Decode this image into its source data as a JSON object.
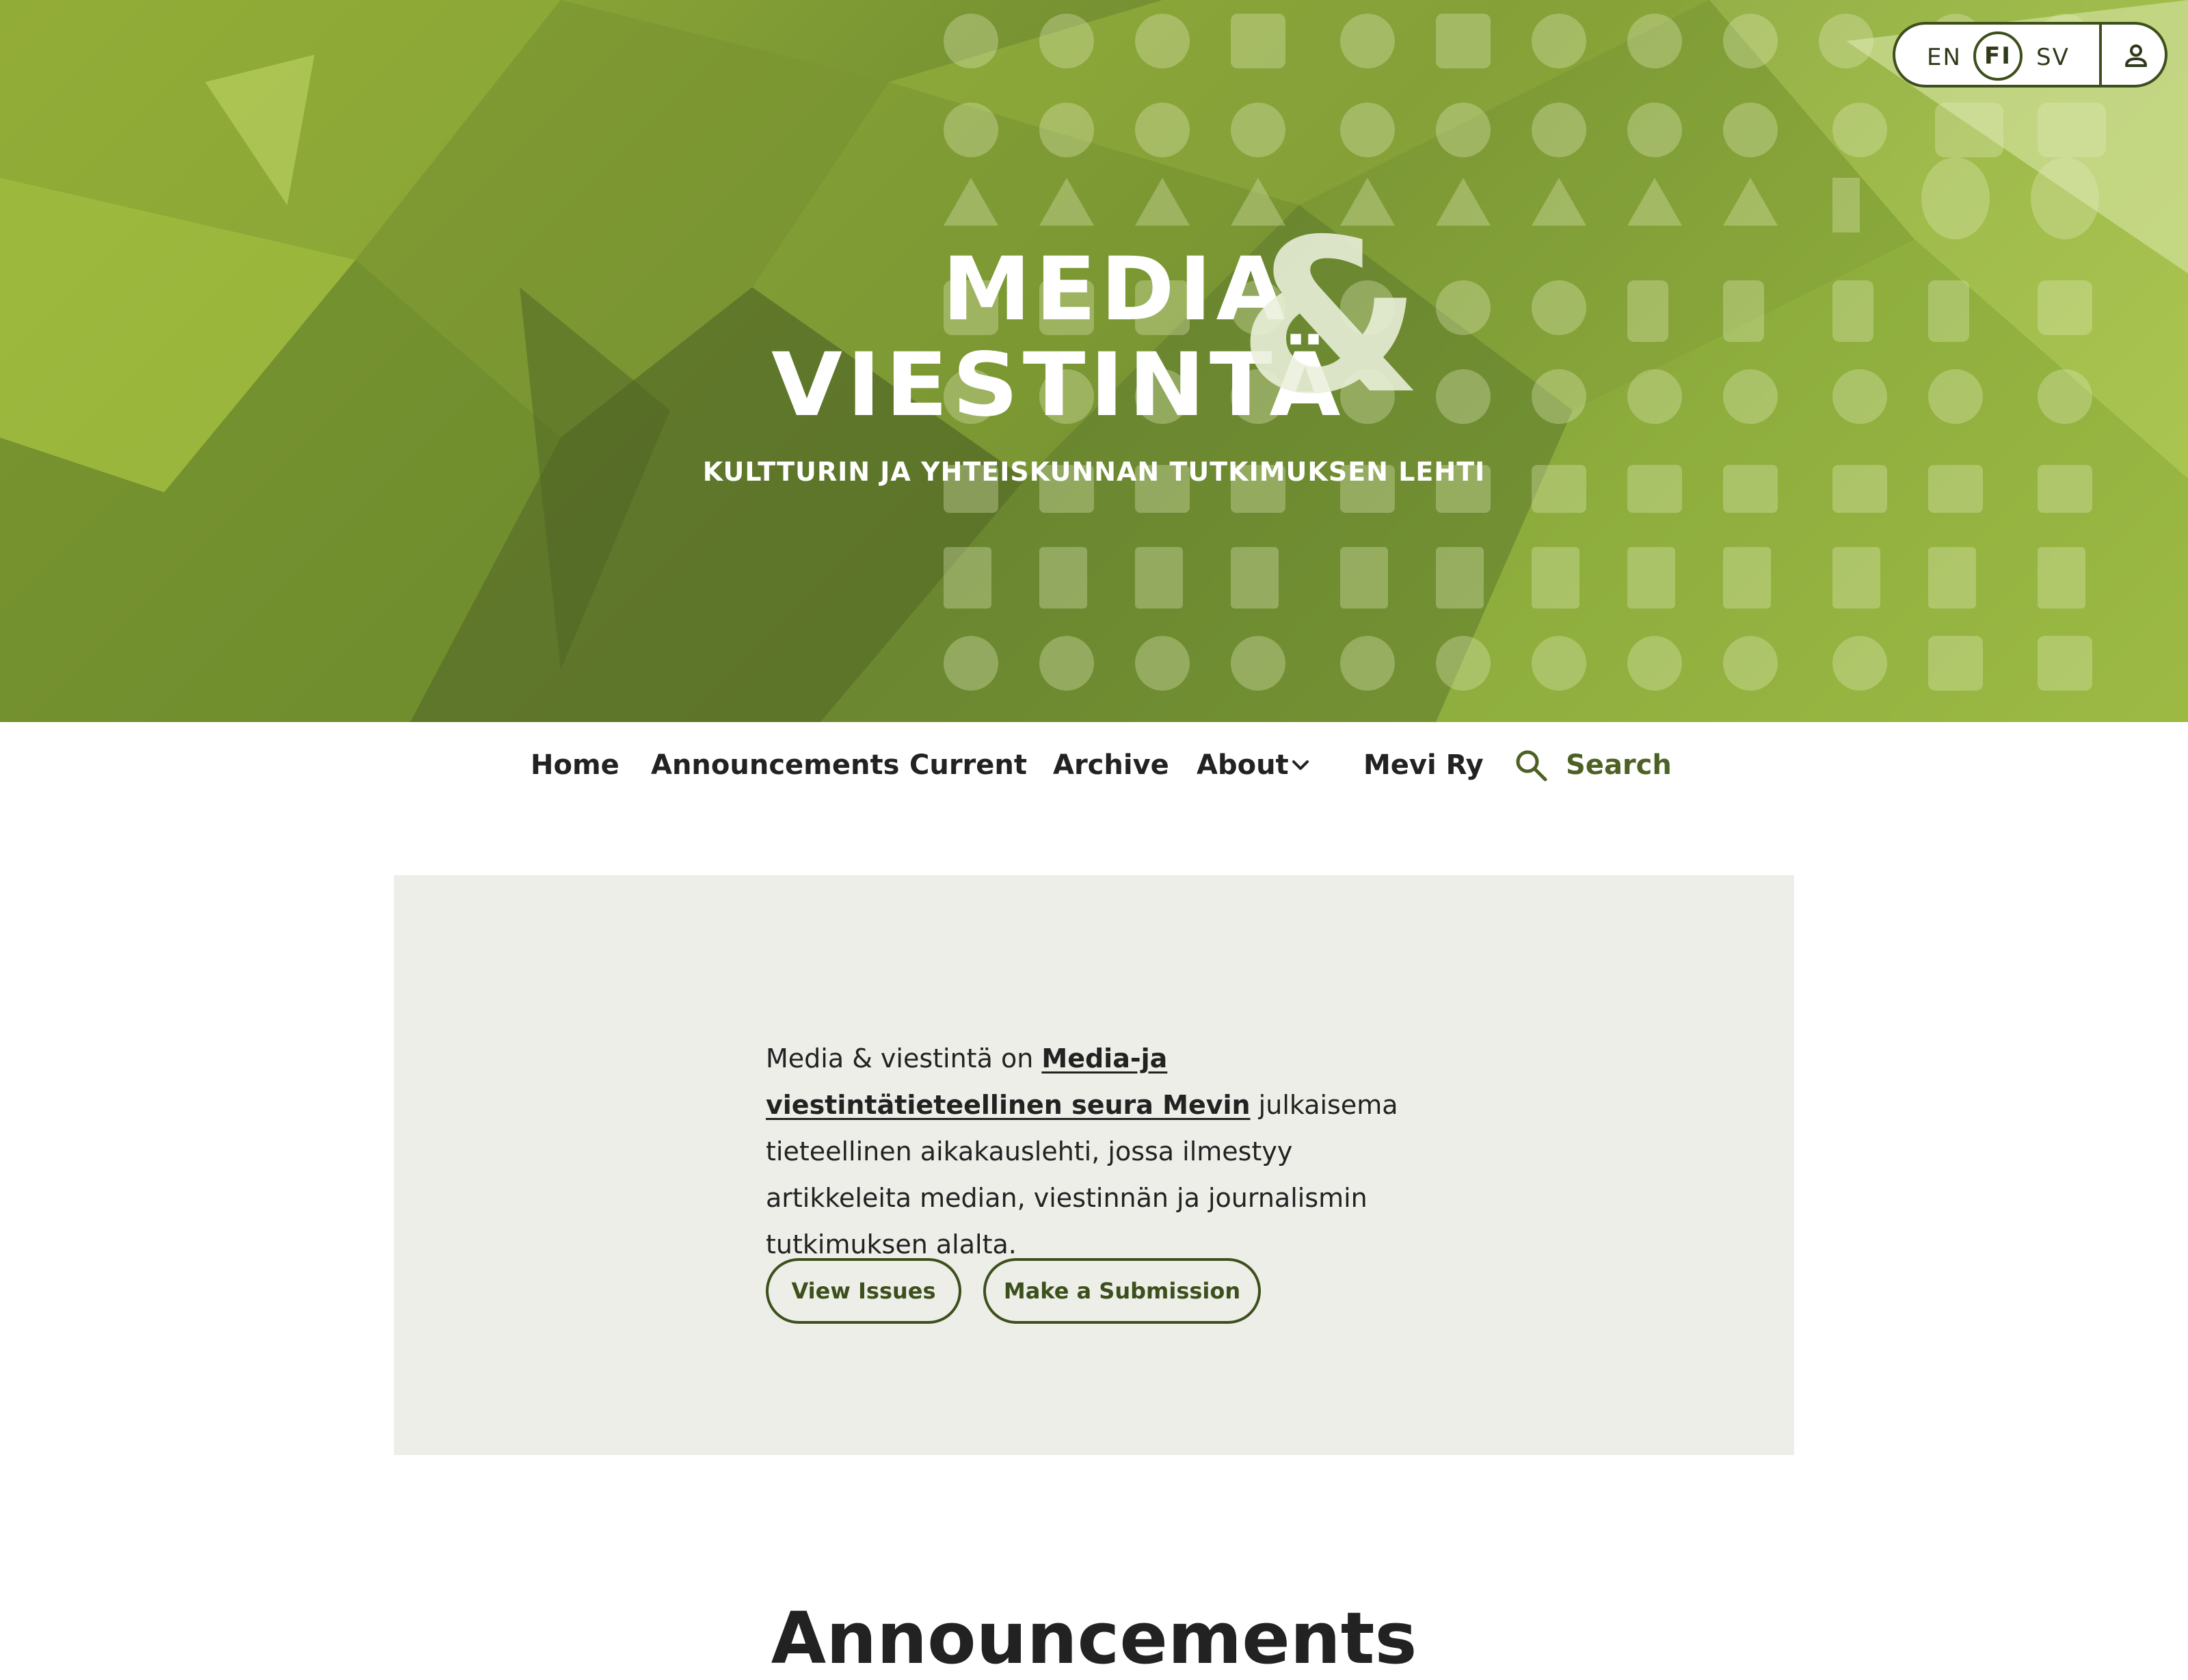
{
  "header": {
    "logo_line1": "MEDIA",
    "logo_line2": "VIESTINTÄ",
    "logo_ampersand": "&",
    "tagline": "KULTTURIN JA YHTEISKUNNAN TUTKIMUKSEN LEHTI",
    "languages": [
      "EN",
      "FI",
      "SV"
    ],
    "active_language": "FI",
    "user_icon": "user-icon"
  },
  "nav": {
    "items": [
      {
        "label": "Home"
      },
      {
        "label": "Announcements"
      },
      {
        "label": "Current"
      },
      {
        "label": "Archive"
      },
      {
        "label": "About"
      },
      {
        "label": "Mevi Ry"
      }
    ],
    "search_label": "Search",
    "search_icon": "search-icon",
    "about_chevron": "chevron-down-icon"
  },
  "hero": {
    "text_before": "Media & viestintä on ",
    "link_text": "Media-ja viestintätieteellinen seura Mevin",
    "text_after": " julkaisema tieteellinen aikakauslehti, jossa ilmestyy artikkeleita median, viestinnän ja journalismin tutkimuksen alalta.",
    "view_issues_label": "View Issues",
    "make_submission_label": "Make a Submission"
  },
  "announcements": {
    "heading": "Announcements"
  },
  "colors": {
    "banner_green": "#7f9b34",
    "accent_dark": "#3d4f1c",
    "search_green": "#4d6124",
    "hero_bg": "#edeee8"
  }
}
